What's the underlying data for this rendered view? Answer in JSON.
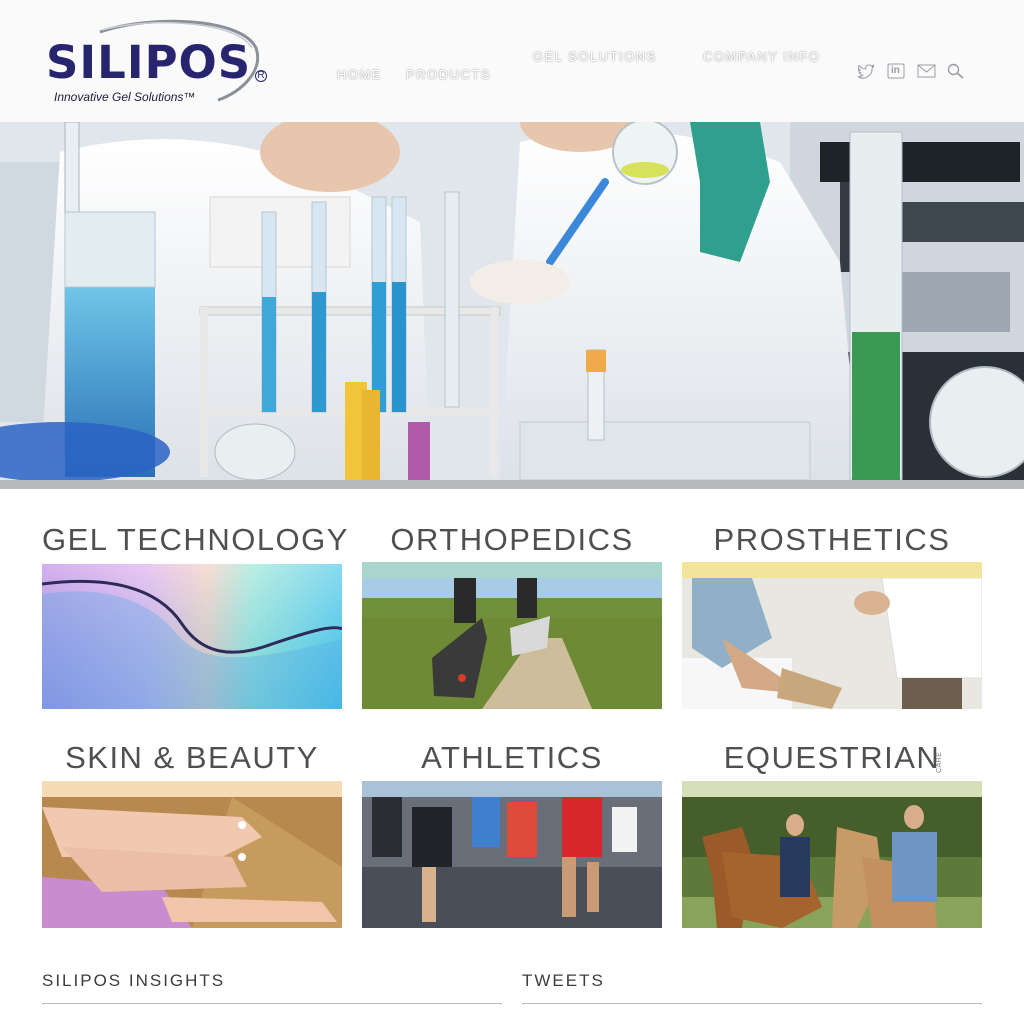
{
  "brand": {
    "name": "SILIPOS",
    "registered": "R",
    "tagline": "Innovative Gel Solutions™",
    "colors": {
      "primary": "#26256e",
      "swoosh": "#8a8f99"
    }
  },
  "nav": {
    "items": [
      {
        "label": "HOME"
      },
      {
        "label": "PRODUCTS"
      },
      {
        "label": "GEL SOLUTIONS"
      },
      {
        "label": "COMPANY INFO"
      }
    ],
    "social": [
      {
        "icon": "twitter-icon"
      },
      {
        "icon": "linkedin-icon",
        "text": "in"
      },
      {
        "icon": "mail-icon"
      },
      {
        "icon": "search-icon"
      }
    ]
  },
  "hero": {
    "image": "laboratory-scientists-photo"
  },
  "categories": [
    {
      "title": "GEL TECHNOLOGY",
      "band_color": "#cdeef2",
      "image": "gel-abstract-photo"
    },
    {
      "title": "ORTHOPEDICS",
      "band_color": "#a9d5cc",
      "image": "runner-trail-photo"
    },
    {
      "title": "PROSTHETICS",
      "band_color": "#f2e49a",
      "image": "prosthetic-fitting-photo"
    },
    {
      "title": "SKIN & BEAUTY",
      "band_color": "#f5dcb5",
      "image": "manicure-pedicure-photo"
    },
    {
      "title": "ATHLETICS",
      "band_color": "#a9c2d8",
      "image": "marathon-runners-photo"
    },
    {
      "title": "EQUESTRIAN",
      "care": "CARE",
      "band_color": "#d5dfb8",
      "image": "horses-photo"
    }
  ],
  "sections": [
    {
      "title": "SILIPOS INSIGHTS"
    },
    {
      "title": "TWEETS"
    }
  ]
}
